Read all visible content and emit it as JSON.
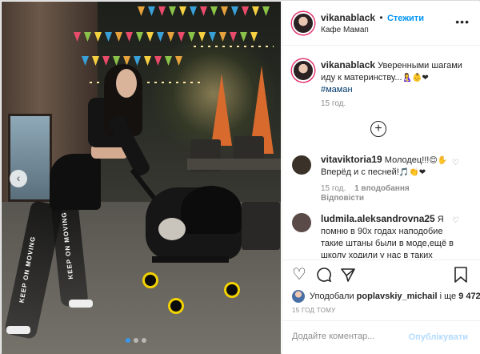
{
  "header": {
    "username": "vikanablack",
    "separator": "•",
    "follow_label": "Стежити",
    "location": "Кафе Мамап",
    "more_icon": "ellipsis-icon"
  },
  "photo": {
    "legs_text_left": "KEEP ON MOVING",
    "legs_text_right": "KEEP ON MOVING",
    "prev_icon": "chevron-left-icon",
    "carousel_count": 3,
    "carousel_active": 1
  },
  "caption": {
    "username": "vikanablack",
    "text": "Уверенными шагами иду к материнству...",
    "emojis": "🤱👶❤",
    "hashtag": "#маман",
    "age": "15 год."
  },
  "load_more_icon": "plus-circle-icon",
  "comments": [
    {
      "username": "vitaviktoria19",
      "text": "Молодец!!!",
      "emojis_inline": "😊✋",
      "text2": "Вперёд и с песней!",
      "emojis2": "🎵👏❤",
      "age": "15 год.",
      "likes": "1 вподобання",
      "reply": "Відповісти",
      "avatar_color": "#3a3128"
    },
    {
      "username": "ludmila.aleksandrovna25",
      "text": "Я помню в 90х годах наподобие такие штаны были в моде,ещё в школу ходили у нас в таких",
      "avatar_color": "#5a4a48"
    }
  ],
  "actions": {
    "like_icon": "heart-icon",
    "comment_icon": "comment-icon",
    "share_icon": "send-icon",
    "save_icon": "bookmark-icon"
  },
  "likes": {
    "prefix": "Уподобали",
    "user": "poplavskiy_michail",
    "and": "і ще",
    "count": "9 472"
  },
  "timestamp": "15 ГОД ТОМУ",
  "add_comment": {
    "placeholder": "Додайте коментар...",
    "publish_label": "Опублікувати"
  },
  "colors": {
    "link": "#0095f6",
    "hashtag": "#00376b",
    "muted": "#8e8e8e",
    "publish_disabled": "#b3dbff"
  }
}
